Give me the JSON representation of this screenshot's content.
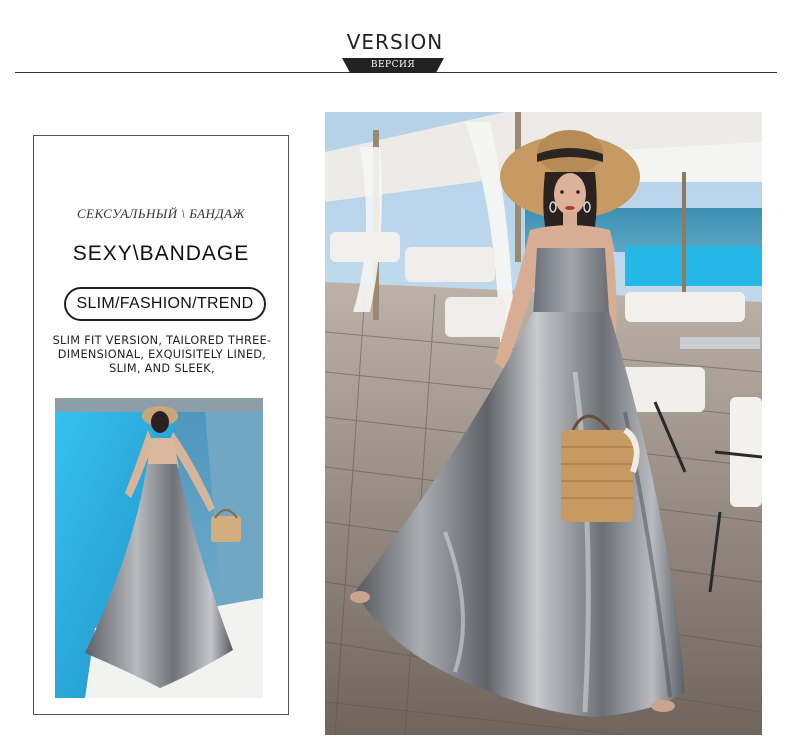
{
  "header": {
    "title": "VERSION",
    "subtitle": "ВЕРСИЯ"
  },
  "card": {
    "russian_title": "СЕКСУАЛЬНЫЙ \\ БАНДАЖ",
    "english_title": "SEXY\\BANDAGE",
    "pill_label": "SLIM/FASHION/TREND",
    "description": [
      "SLIM FIT VERSION, TAILORED THREE-",
      "DIMENSIONAL, EXQUISITELY LINED,",
      "SLIM, AND SLEEK,"
    ]
  },
  "colors": {
    "pool": "#2bb3e0",
    "sea": "#3f8fb8",
    "sky": "#b9d6ec",
    "deck": "#8f8378",
    "dress": "#8d9096",
    "straw": "#c79a63"
  },
  "images": {
    "thumbnail": "back-view-silver-dress-photo",
    "main": "front-view-silver-dress-photo"
  }
}
